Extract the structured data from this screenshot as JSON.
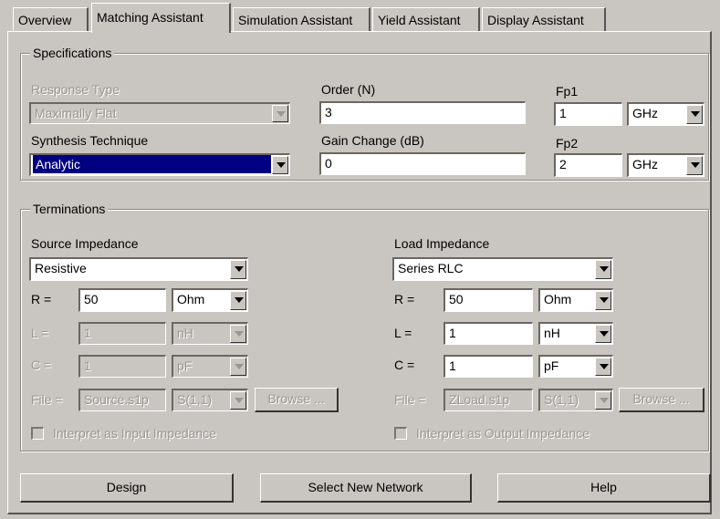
{
  "tabs": [
    "Overview",
    "Matching Assistant",
    "Simulation Assistant",
    "Yield Assistant",
    "Display Assistant"
  ],
  "active_tab": "Matching Assistant",
  "specifications": {
    "legend": "Specifications",
    "response_type_label": "Response Type",
    "response_type_value": "Maximally Flat",
    "synthesis_label": "Synthesis Technique",
    "synthesis_value": "Analytic",
    "order_label": "Order (N)",
    "order_value": "3",
    "gain_label": "Gain Change (dB)",
    "gain_value": "0",
    "fp1_label": "Fp1",
    "fp1_value": "1",
    "fp1_unit": "GHz",
    "fp2_label": "Fp2",
    "fp2_value": "2",
    "fp2_unit": "GHz"
  },
  "terminations": {
    "legend": "Terminations",
    "source": {
      "title": "Source Impedance",
      "type": "Resistive",
      "r_label": "R =",
      "r_value": "50",
      "r_unit": "Ohm",
      "l_label": "L =",
      "l_value": "1",
      "l_unit": "nH",
      "c_label": "C =",
      "c_value": "1",
      "c_unit": "pF",
      "file_label": "File =",
      "file_value": "Source.s1p",
      "param": "S(1,1)",
      "browse": "Browse ...",
      "interpret": "Interpret as Input Impedance"
    },
    "load": {
      "title": "Load Impedance",
      "type": "Series RLC",
      "r_label": "R =",
      "r_value": "50",
      "r_unit": "Ohm",
      "l_label": "L =",
      "l_value": "1",
      "l_unit": "nH",
      "c_label": "C =",
      "c_value": "1",
      "c_unit": "pF",
      "file_label": "File =",
      "file_value": "ZLoad.s1p",
      "param": "S(1,1)",
      "browse": "Browse ...",
      "interpret": "Interpret as Output Impedance"
    }
  },
  "buttons": {
    "design": "Design",
    "select_network": "Select New Network",
    "help": "Help"
  }
}
